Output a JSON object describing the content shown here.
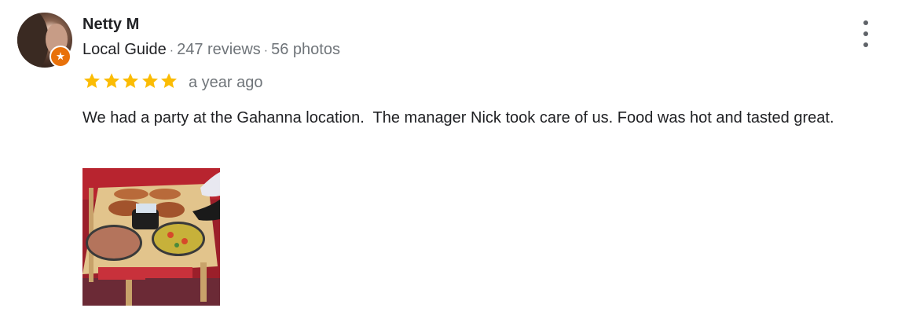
{
  "reviewer": {
    "name": "Netty M",
    "guide_label": "Local Guide",
    "reviews_count": "247 reviews",
    "photos_count": "56 photos",
    "separator": "·"
  },
  "review": {
    "rating": 5,
    "max_rating": 5,
    "time_ago": "a year ago",
    "text": "We had a party at the Gahanna location.  The manager Nick took care of us. Food was hot and tasted great."
  },
  "icons": {
    "badge": "local-guide-badge-icon",
    "menu": "more-vert-icon",
    "star": "star-icon"
  },
  "colors": {
    "star": "#fbbc04",
    "guide_badge": "#e8710a",
    "secondary_text": "#70757a",
    "primary_text": "#202124",
    "menu_dots": "#5f6368"
  },
  "photos": [
    {
      "name": "review-photo-pizza-party"
    }
  ]
}
